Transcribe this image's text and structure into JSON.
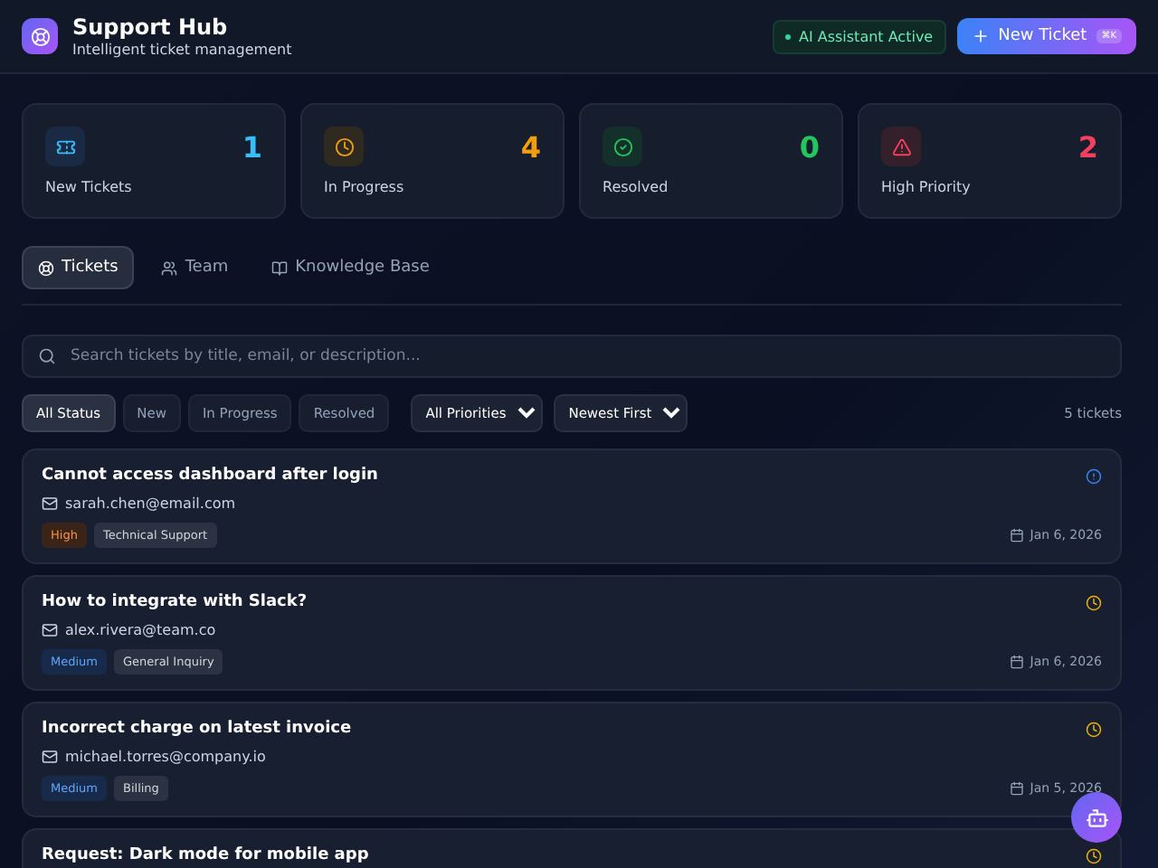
{
  "header": {
    "title": "Support Hub",
    "subtitle": "Intelligent ticket management",
    "ai_status": {
      "label": "AI Assistant Active",
      "on": true
    },
    "new_button": {
      "label": "New Ticket",
      "shortcut": "⌘K"
    }
  },
  "stats": [
    {
      "kind": "ticket",
      "value": "1",
      "label": "New Tickets",
      "color": "#38bdf8"
    },
    {
      "kind": "clock",
      "value": "4",
      "label": "In Progress",
      "color": "#f59e0b"
    },
    {
      "kind": "check",
      "value": "0",
      "label": "Resolved",
      "color": "#22c55e"
    },
    {
      "kind": "alert",
      "value": "2",
      "label": "High Priority",
      "color": "#f43f5e"
    }
  ],
  "tabs": [
    {
      "kind": "tickets",
      "label": "Tickets",
      "selected": true
    },
    {
      "kind": "team",
      "label": "Team",
      "selected": false
    },
    {
      "kind": "book",
      "label": "Knowledge Base",
      "selected": false
    }
  ],
  "search": {
    "placeholder": "Search tickets by title, email, or description..."
  },
  "status_filters": [
    {
      "label": "All Status",
      "selected": true
    },
    {
      "label": "New",
      "selected": false
    },
    {
      "label": "In Progress",
      "selected": false
    },
    {
      "label": "Resolved",
      "selected": false
    }
  ],
  "priority_select": "All Priorities",
  "sort_select": "Newest First",
  "count": "5 tickets",
  "tickets": [
    {
      "title": "Cannot access dashboard after login",
      "email": "sarah.chen@email.com",
      "priority": {
        "label": "High",
        "kind": "high"
      },
      "category": "Technical Support",
      "date": "Jan 6, 2026",
      "kind": "new"
    },
    {
      "title": "How to integrate with Slack?",
      "email": "alex.rivera@team.co",
      "priority": {
        "label": "Medium",
        "kind": "medium"
      },
      "category": "General Inquiry",
      "date": "Jan 6, 2026",
      "kind": "progress"
    },
    {
      "title": "Incorrect charge on latest invoice",
      "email": "michael.torres@company.io",
      "priority": {
        "label": "Medium",
        "kind": "medium"
      },
      "category": "Billing",
      "date": "Jan 5, 2026",
      "kind": "progress"
    },
    {
      "title": "Request: Dark mode for mobile app",
      "kind": "progress"
    }
  ]
}
